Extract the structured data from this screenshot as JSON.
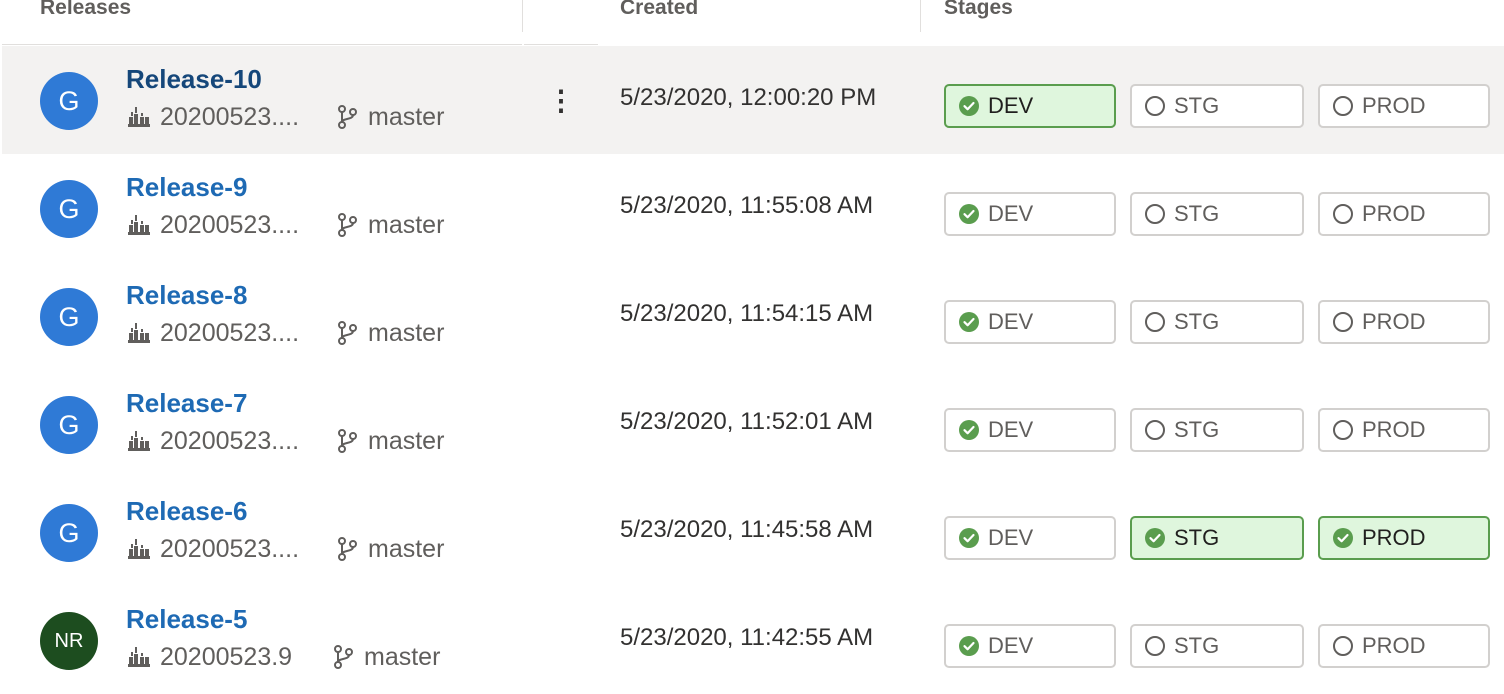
{
  "header": {
    "releases_label": "Releases",
    "created_label": "Created",
    "stages_label": "Stages"
  },
  "colors": {
    "avatar_g": "#2f7ad6",
    "avatar_nr": "#1d4d1f",
    "link": "#1e6ab4",
    "success_green": "#5a9d4e",
    "success_bg": "#dff6dd",
    "selected_row_bg": "#f3f2f1"
  },
  "icons": {
    "build": "build-pipeline-icon",
    "branch": "git-branch-icon",
    "stage_succeeded": "check-circle-icon",
    "stage_not_deployed": "empty-circle-icon",
    "more": "more-vertical-icon"
  },
  "rows": [
    {
      "avatar": "G",
      "name": "Release-10",
      "build": "20200523....",
      "branch": "master",
      "more": "⋮",
      "created": "5/23/2020, 12:00:20 PM",
      "stages": [
        {
          "name": "DEV",
          "status": "succeeded"
        },
        {
          "name": "STG",
          "status": "not-deployed"
        },
        {
          "name": "PROD",
          "status": "not-deployed"
        }
      ]
    },
    {
      "avatar": "G",
      "name": "Release-9",
      "build": "20200523....",
      "branch": "master",
      "created": "5/23/2020, 11:55:08 AM",
      "stages": [
        {
          "name": "DEV",
          "status": "succeeded"
        },
        {
          "name": "STG",
          "status": "not-deployed"
        },
        {
          "name": "PROD",
          "status": "not-deployed"
        }
      ]
    },
    {
      "avatar": "G",
      "name": "Release-8",
      "build": "20200523....",
      "branch": "master",
      "created": "5/23/2020, 11:54:15 AM",
      "stages": [
        {
          "name": "DEV",
          "status": "succeeded"
        },
        {
          "name": "STG",
          "status": "not-deployed"
        },
        {
          "name": "PROD",
          "status": "not-deployed"
        }
      ]
    },
    {
      "avatar": "G",
      "name": "Release-7",
      "build": "20200523....",
      "branch": "master",
      "created": "5/23/2020, 11:52:01 AM",
      "stages": [
        {
          "name": "DEV",
          "status": "succeeded"
        },
        {
          "name": "STG",
          "status": "not-deployed"
        },
        {
          "name": "PROD",
          "status": "not-deployed"
        }
      ]
    },
    {
      "avatar": "G",
      "name": "Release-6",
      "build": "20200523....",
      "branch": "master",
      "created": "5/23/2020, 11:45:58 AM",
      "stages": [
        {
          "name": "DEV",
          "status": "succeeded"
        },
        {
          "name": "STG",
          "status": "succeeded"
        },
        {
          "name": "PROD",
          "status": "succeeded"
        }
      ]
    },
    {
      "avatar": "NR",
      "name": "Release-5",
      "build": "20200523.9",
      "branch": "master",
      "created": "5/23/2020, 11:42:55 AM",
      "stages": [
        {
          "name": "DEV",
          "status": "succeeded"
        },
        {
          "name": "STG",
          "status": "not-deployed"
        },
        {
          "name": "PROD",
          "status": "not-deployed"
        }
      ]
    }
  ]
}
